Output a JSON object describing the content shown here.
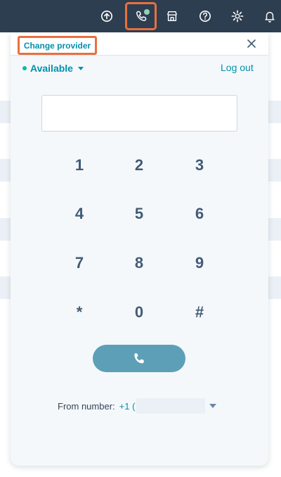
{
  "topbar": {
    "icons": [
      "upgrade-icon",
      "calling-icon",
      "marketplace-icon",
      "help-icon",
      "settings-icon",
      "notifications-icon"
    ]
  },
  "panel": {
    "change_provider": "Change provider",
    "status": "Available",
    "logout": "Log out",
    "number_input": {
      "value": "",
      "placeholder": ""
    },
    "keys": [
      "1",
      "2",
      "3",
      "4",
      "5",
      "6",
      "7",
      "8",
      "9",
      "*",
      "0",
      "#"
    ],
    "from_label": "From number:",
    "from_prefix": "+1 (",
    "colors": {
      "accent": "#0091ae",
      "call_button": "#5e9fb8",
      "highlight": "#e9703e",
      "status_dot": "#00bda5"
    }
  }
}
